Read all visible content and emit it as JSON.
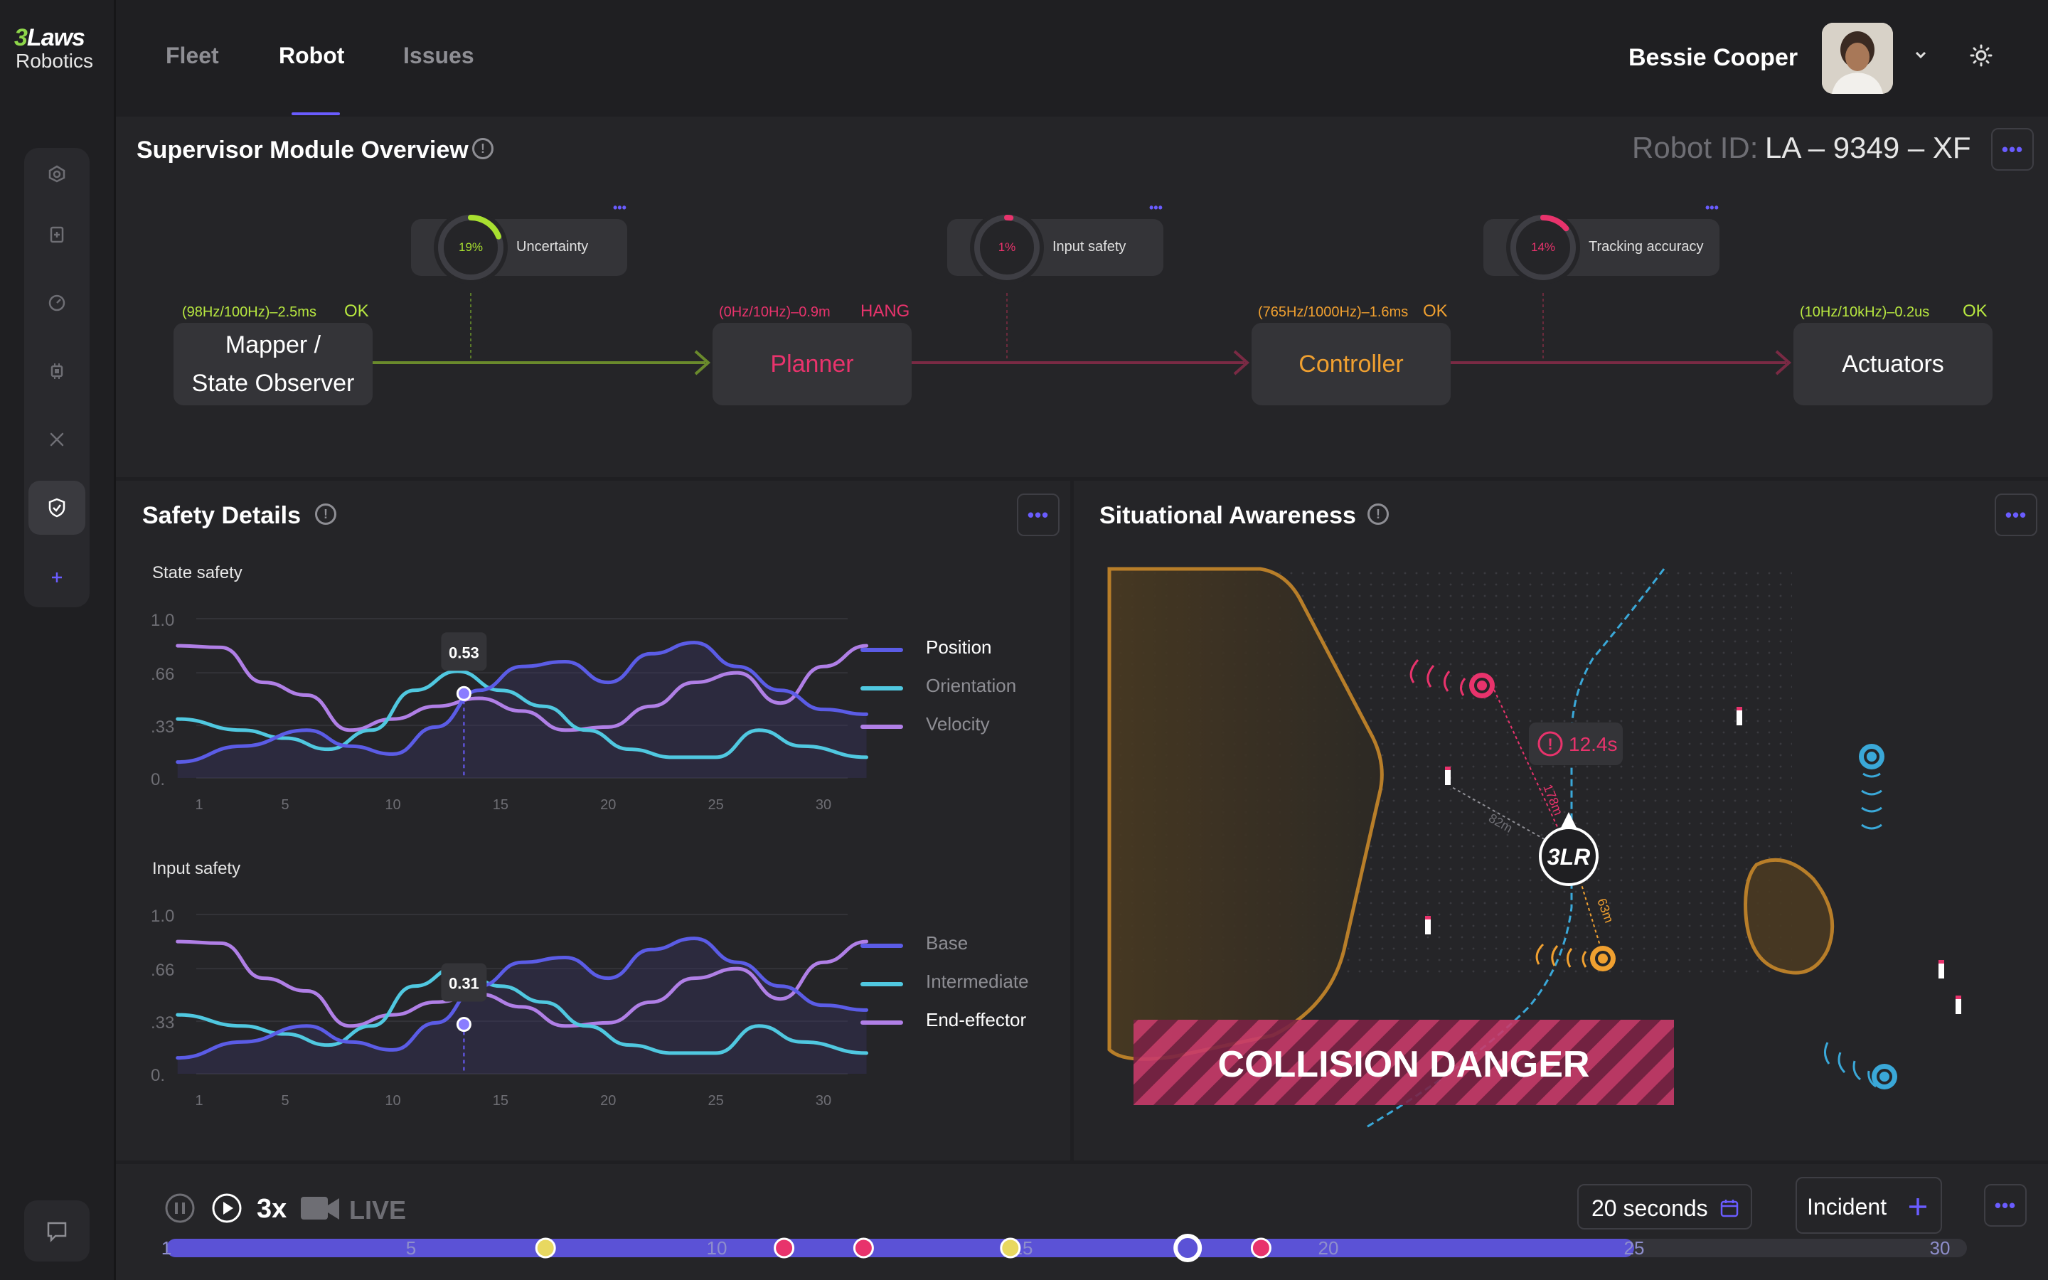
{
  "app": {
    "logo_line1_prefix": "3",
    "logo_line1_rest": "Laws",
    "logo_line2": "Robotics"
  },
  "nav": {
    "tabs": [
      {
        "label": "Fleet"
      },
      {
        "label": "Robot"
      },
      {
        "label": "Issues"
      }
    ],
    "active_tab": "Robot"
  },
  "user": {
    "name": "Bessie Cooper"
  },
  "supervisor": {
    "title": "Supervisor Module Overview",
    "robot_id_label": "Robot ID:",
    "robot_id": "LA – 9349 – XF",
    "nodes": [
      {
        "name_line1": "Mapper /",
        "name_line2": "State Observer",
        "meta": "(98Hz/100Hz)–2.5ms",
        "status": "OK"
      },
      {
        "name_line1": "Planner",
        "meta": "(0Hz/10Hz)–0.9m",
        "status": "HANG"
      },
      {
        "name_line1": "Controller",
        "meta": "(765Hz/1000Hz)–1.6ms",
        "status": "OK"
      },
      {
        "name_line1": "Actuators",
        "meta": "(10Hz/10kHz)–0.2us",
        "status": "OK"
      }
    ],
    "gauges": [
      {
        "label": "Uncertainty",
        "value_text": "19%",
        "value": 0.19
      },
      {
        "label": "Input safety",
        "value_text": "1%",
        "value": 0.01
      },
      {
        "label": "Tracking accuracy",
        "value_text": "14%",
        "value": 0.14
      }
    ],
    "colors": {
      "ok": "#b8e840",
      "hang": "#e8336c",
      "warn": "#f0a030",
      "planner_text": "#e8336c",
      "controller_text": "#f0a030"
    }
  },
  "safety": {
    "title": "Safety Details"
  },
  "chart_data": [
    {
      "type": "line",
      "title": "State safety",
      "x_ticks": [
        1,
        5,
        10,
        15,
        20,
        25,
        30
      ],
      "y_ticks": [
        "1.0",
        ".66",
        ".33",
        "0."
      ],
      "ylim": [
        0,
        1
      ],
      "xlim": [
        1,
        30
      ],
      "tooltip": {
        "x": 13.3,
        "y": 0.53,
        "label": "0.53"
      },
      "series": [
        {
          "name": "Position",
          "color": "#5b5ce6",
          "values": [
            [
              0,
              0.1
            ],
            [
              3,
              0.2
            ],
            [
              6,
              0.3
            ],
            [
              8,
              0.2
            ],
            [
              10,
              0.15
            ],
            [
              12,
              0.32
            ],
            [
              14,
              0.55
            ],
            [
              16,
              0.7
            ],
            [
              18,
              0.73
            ],
            [
              20,
              0.6
            ],
            [
              22,
              0.78
            ],
            [
              24,
              0.85
            ],
            [
              26,
              0.7
            ],
            [
              28,
              0.55
            ],
            [
              30,
              0.43
            ],
            [
              32,
              0.4
            ]
          ]
        },
        {
          "name": "Orientation",
          "color": "#50c8e0",
          "values": [
            [
              0,
              0.37
            ],
            [
              3,
              0.3
            ],
            [
              5,
              0.25
            ],
            [
              7,
              0.18
            ],
            [
              9,
              0.3
            ],
            [
              11,
              0.55
            ],
            [
              13,
              0.67
            ],
            [
              15,
              0.55
            ],
            [
              17,
              0.45
            ],
            [
              19,
              0.3
            ],
            [
              21,
              0.18
            ],
            [
              23,
              0.13
            ],
            [
              25,
              0.13
            ],
            [
              27,
              0.3
            ],
            [
              29,
              0.2
            ],
            [
              32,
              0.13
            ]
          ]
        },
        {
          "name": "Velocity",
          "color": "#b07fe6",
          "values": [
            [
              0,
              0.83
            ],
            [
              2,
              0.82
            ],
            [
              4,
              0.6
            ],
            [
              6,
              0.52
            ],
            [
              8,
              0.3
            ],
            [
              10,
              0.37
            ],
            [
              12,
              0.45
            ],
            [
              14,
              0.5
            ],
            [
              16,
              0.42
            ],
            [
              18,
              0.3
            ],
            [
              20,
              0.32
            ],
            [
              22,
              0.45
            ],
            [
              24,
              0.6
            ],
            [
              26,
              0.66
            ],
            [
              28,
              0.47
            ],
            [
              30,
              0.7
            ],
            [
              32,
              0.83
            ]
          ]
        }
      ]
    },
    {
      "type": "line",
      "title": "Input safety",
      "x_ticks": [
        1,
        5,
        10,
        15,
        20,
        25,
        30
      ],
      "y_ticks": [
        "1.0",
        ".66",
        ".33",
        "0."
      ],
      "ylim": [
        0,
        1
      ],
      "xlim": [
        1,
        30
      ],
      "tooltip": {
        "x": 13.3,
        "y": 0.31,
        "label": "0.31"
      },
      "series": [
        {
          "name": "Base",
          "color": "#5b5ce6",
          "values": [
            [
              0,
              0.1
            ],
            [
              3,
              0.2
            ],
            [
              6,
              0.3
            ],
            [
              8,
              0.2
            ],
            [
              10,
              0.15
            ],
            [
              12,
              0.32
            ],
            [
              14,
              0.55
            ],
            [
              16,
              0.7
            ],
            [
              18,
              0.73
            ],
            [
              20,
              0.6
            ],
            [
              22,
              0.78
            ],
            [
              24,
              0.85
            ],
            [
              26,
              0.7
            ],
            [
              28,
              0.55
            ],
            [
              30,
              0.43
            ],
            [
              32,
              0.4
            ]
          ]
        },
        {
          "name": "Intermediate",
          "color": "#50c8e0",
          "values": [
            [
              0,
              0.37
            ],
            [
              3,
              0.3
            ],
            [
              5,
              0.25
            ],
            [
              7,
              0.18
            ],
            [
              9,
              0.3
            ],
            [
              11,
              0.55
            ],
            [
              13,
              0.67
            ],
            [
              15,
              0.55
            ],
            [
              17,
              0.45
            ],
            [
              19,
              0.3
            ],
            [
              21,
              0.18
            ],
            [
              23,
              0.13
            ],
            [
              25,
              0.13
            ],
            [
              27,
              0.3
            ],
            [
              29,
              0.2
            ],
            [
              32,
              0.13
            ]
          ]
        },
        {
          "name": "End-effector",
          "color": "#b07fe6",
          "values": [
            [
              0,
              0.83
            ],
            [
              2,
              0.82
            ],
            [
              4,
              0.6
            ],
            [
              6,
              0.52
            ],
            [
              8,
              0.3
            ],
            [
              10,
              0.37
            ],
            [
              12,
              0.45
            ],
            [
              14,
              0.5
            ],
            [
              16,
              0.42
            ],
            [
              18,
              0.3
            ],
            [
              20,
              0.32
            ],
            [
              22,
              0.45
            ],
            [
              24,
              0.6
            ],
            [
              26,
              0.66
            ],
            [
              28,
              0.47
            ],
            [
              30,
              0.7
            ],
            [
              32,
              0.83
            ]
          ]
        }
      ]
    }
  ],
  "awareness": {
    "title": "Situational Awareness",
    "time_to_collision": "12.4s",
    "robot_label": "3LR",
    "distances": [
      "178m",
      "82m",
      "63m"
    ],
    "danger_text": "COLLISION DANGER"
  },
  "timeline": {
    "speed": "3x",
    "live_label": "LIVE",
    "duration": "20 seconds",
    "incident_label": "Incident",
    "ticks": [
      "1",
      "5",
      "10",
      "15",
      "20",
      "25",
      "30"
    ],
    "markers": [
      {
        "t": 7.2,
        "color": "#e8d860"
      },
      {
        "t": 11.1,
        "color": "#e8336c"
      },
      {
        "t": 12.4,
        "color": "#e8336c"
      },
      {
        "t": 14.8,
        "color": "#e8d860"
      },
      {
        "t": 17.7,
        "color": "#ffffff",
        "current": true
      },
      {
        "t": 18.9,
        "color": "#e8336c"
      }
    ],
    "progress_end": 25
  }
}
